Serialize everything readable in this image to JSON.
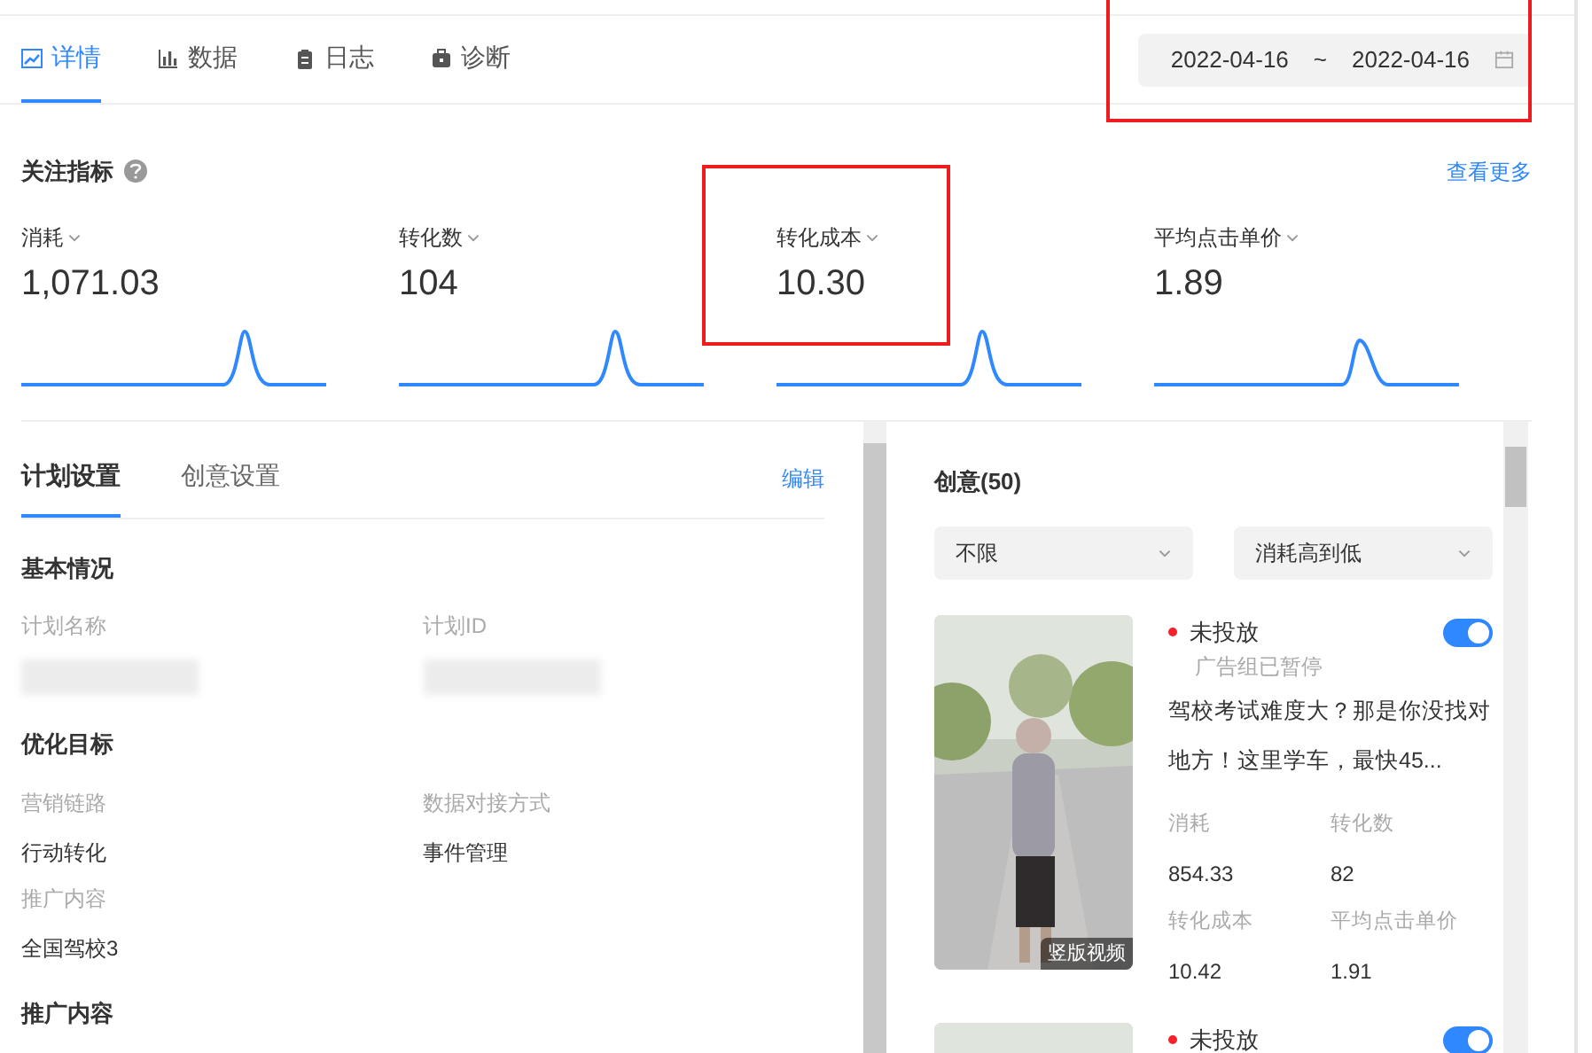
{
  "tabs": [
    {
      "label": "详情",
      "selected": true
    },
    {
      "label": "数据",
      "selected": false
    },
    {
      "label": "日志",
      "selected": false
    },
    {
      "label": "诊断",
      "selected": false
    }
  ],
  "date_range": {
    "start": "2022-04-16",
    "separator": "~",
    "end": "2022-04-16",
    "highlighted": true
  },
  "metrics_section": {
    "title": "关注指标",
    "link": "查看更多"
  },
  "metrics": [
    {
      "label": "消耗",
      "value": "1,071.03",
      "highlighted": false
    },
    {
      "label": "转化数",
      "value": "104",
      "highlighted": false
    },
    {
      "label": "转化成本",
      "value": "10.30",
      "highlighted": true
    },
    {
      "label": "平均点击单价",
      "value": "1.89",
      "highlighted": false
    }
  ],
  "settings_panel": {
    "tabs": [
      {
        "label": "计划设置",
        "selected": true
      },
      {
        "label": "创意设置",
        "selected": false
      }
    ],
    "edit_link": "编辑",
    "sections": [
      {
        "title": "基本情况",
        "fields": [
          {
            "label": "计划名称",
            "redacted": true
          },
          {
            "label": "计划ID",
            "redacted": true
          }
        ]
      },
      {
        "title": "优化目标",
        "fields": [
          {
            "label": "营销链路",
            "value": "行动转化"
          },
          {
            "label": "数据对接方式",
            "value": "事件管理"
          },
          {
            "label": "推广内容",
            "value": "全国驾校3"
          }
        ]
      },
      {
        "title": "推广内容"
      }
    ]
  },
  "creatives_panel": {
    "title": "创意(50)",
    "filters": [
      {
        "value": "不限"
      },
      {
        "value": "消耗高到低"
      }
    ],
    "cards": [
      {
        "status": "未投放",
        "color": "#f5222d",
        "substatus": "广告组已暂停",
        "on": true,
        "badge": "竖版视频",
        "text": "驾校考试难度大？那是你没找对地方！这里学车，最快45...",
        "stats": [
          {
            "label": "消耗",
            "value": "854.33"
          },
          {
            "label": "转化数",
            "value": "82"
          },
          {
            "label": "转化成本",
            "value": "10.42"
          },
          {
            "label": "平均点击单价",
            "value": "1.91"
          }
        ]
      },
      {
        "status": "未投放",
        "color": "#f5222d",
        "on": true
      }
    ]
  }
}
